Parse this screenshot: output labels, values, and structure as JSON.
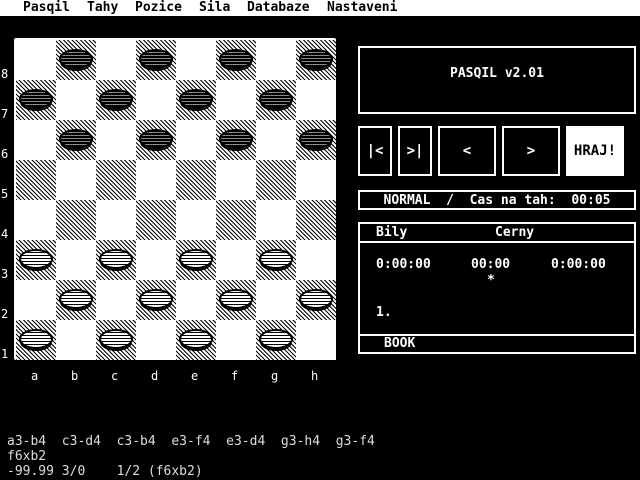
{
  "menu": [
    "Pasqil",
    "Tahy",
    "Pozice",
    "Sila",
    "Databaze",
    "Nastaveni"
  ],
  "board": {
    "ranks": [
      "8",
      "7",
      "6",
      "5",
      "4",
      "3",
      "2",
      "1"
    ],
    "files": [
      "a",
      "b",
      "c",
      "d",
      "e",
      "f",
      "g",
      "h"
    ],
    "pieces": [
      {
        "sq": "b8",
        "color": "black"
      },
      {
        "sq": "d8",
        "color": "black"
      },
      {
        "sq": "f8",
        "color": "black"
      },
      {
        "sq": "h8",
        "color": "black"
      },
      {
        "sq": "a7",
        "color": "black"
      },
      {
        "sq": "c7",
        "color": "black"
      },
      {
        "sq": "e7",
        "color": "black"
      },
      {
        "sq": "g7",
        "color": "black"
      },
      {
        "sq": "b6",
        "color": "black"
      },
      {
        "sq": "d6",
        "color": "black"
      },
      {
        "sq": "f6",
        "color": "black"
      },
      {
        "sq": "h6",
        "color": "black"
      },
      {
        "sq": "a3",
        "color": "white"
      },
      {
        "sq": "c3",
        "color": "white"
      },
      {
        "sq": "e3",
        "color": "white"
      },
      {
        "sq": "g3",
        "color": "white"
      },
      {
        "sq": "b2",
        "color": "white"
      },
      {
        "sq": "d2",
        "color": "white"
      },
      {
        "sq": "f2",
        "color": "white"
      },
      {
        "sq": "h2",
        "color": "white"
      },
      {
        "sq": "a1",
        "color": "white"
      },
      {
        "sq": "c1",
        "color": "white"
      },
      {
        "sq": "e1",
        "color": "white"
      },
      {
        "sq": "g1",
        "color": "white"
      }
    ]
  },
  "title": "PASQIL v2.01",
  "buttons": {
    "first": "|<",
    "last": ">|",
    "prev": "<",
    "next": ">",
    "play": "HRAJ!"
  },
  "status": {
    "mode": "NORMAL",
    "separator": "/",
    "time_label": "Cas na tah:",
    "time_value": "00:05"
  },
  "clock": {
    "white_label": "Bily",
    "black_label": "Cerny",
    "white_time": "0:00:00",
    "move_time": "00:00",
    "black_time": "0:00:00",
    "turn_marker": "*",
    "move_number": "1.",
    "book": "BOOK"
  },
  "moves": {
    "line1": "a3-b4  c3-d4  c3-b4  e3-f4  e3-d4  g3-h4  g3-f4",
    "line2": "f6xb2"
  },
  "status_line": "-99.99 3/0    1/2 (f6xb2)"
}
